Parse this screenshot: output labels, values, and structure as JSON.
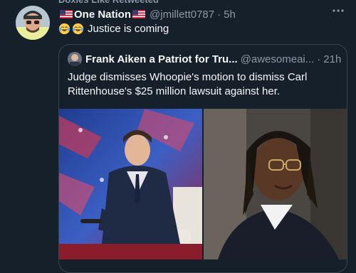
{
  "retweet": {
    "label": "Doxies Like Retweeted"
  },
  "tweet": {
    "display_name": "One Nation",
    "handle": "@jmillett0787",
    "separator": "·",
    "time": "5h",
    "text": "Justice is coming",
    "more_icon": "more-horizontal-icon"
  },
  "quoted_tweet": {
    "display_name": "Frank Aiken a Patriot for Tru...",
    "handle": "@awesomeai...",
    "separator": "·",
    "time": "21h",
    "text": "Judge dismisses Whoopie's  motion to dismiss Carl Rittenhouse's $25 million lawsuit against her."
  },
  "colors": {
    "background": "#15202b",
    "text": "#f7f9f9",
    "secondary_text": "#8b98a5",
    "border": "#38444d"
  }
}
